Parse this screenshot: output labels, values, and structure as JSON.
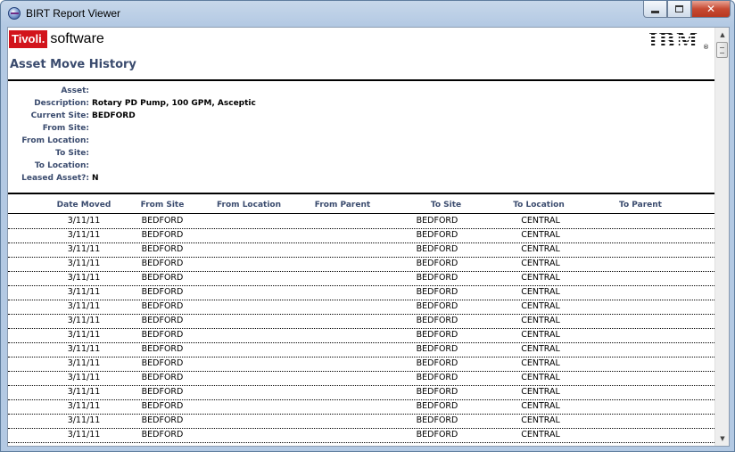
{
  "window": {
    "title": "BIRT Report Viewer",
    "minimize_label": "",
    "maximize_label": "",
    "close_label": "✕"
  },
  "header": {
    "brand_mark": "Tivoli.",
    "brand_text": "software",
    "ibm": "IBM",
    "ibm_reg": "®",
    "report_title": "Asset Move History"
  },
  "fields": [
    {
      "label": "Asset:",
      "value": ""
    },
    {
      "label": "Description:",
      "value": "Rotary PD Pump, 100 GPM, Asceptic"
    },
    {
      "label": "Current Site:",
      "value": "BEDFORD"
    },
    {
      "label": "From Site:",
      "value": ""
    },
    {
      "label": "From Location:",
      "value": ""
    },
    {
      "label": "To Site:",
      "value": ""
    },
    {
      "label": "To Location:",
      "value": ""
    },
    {
      "label": "Leased Asset?:",
      "value": "N"
    }
  ],
  "table": {
    "columns": [
      "Date Moved",
      "From Site",
      "From Location",
      "From Parent",
      "To Site",
      "To Location",
      "To Parent"
    ],
    "rows": [
      [
        "3/11/11",
        "BEDFORD",
        "",
        "",
        "BEDFORD",
        "CENTRAL",
        ""
      ],
      [
        "3/11/11",
        "BEDFORD",
        "",
        "",
        "BEDFORD",
        "CENTRAL",
        ""
      ],
      [
        "3/11/11",
        "BEDFORD",
        "",
        "",
        "BEDFORD",
        "CENTRAL",
        ""
      ],
      [
        "3/11/11",
        "BEDFORD",
        "",
        "",
        "BEDFORD",
        "CENTRAL",
        ""
      ],
      [
        "3/11/11",
        "BEDFORD",
        "",
        "",
        "BEDFORD",
        "CENTRAL",
        ""
      ],
      [
        "3/11/11",
        "BEDFORD",
        "",
        "",
        "BEDFORD",
        "CENTRAL",
        ""
      ],
      [
        "3/11/11",
        "BEDFORD",
        "",
        "",
        "BEDFORD",
        "CENTRAL",
        ""
      ],
      [
        "3/11/11",
        "BEDFORD",
        "",
        "",
        "BEDFORD",
        "CENTRAL",
        ""
      ],
      [
        "3/11/11",
        "BEDFORD",
        "",
        "",
        "BEDFORD",
        "CENTRAL",
        ""
      ],
      [
        "3/11/11",
        "BEDFORD",
        "",
        "",
        "BEDFORD",
        "CENTRAL",
        ""
      ],
      [
        "3/11/11",
        "BEDFORD",
        "",
        "",
        "BEDFORD",
        "CENTRAL",
        ""
      ],
      [
        "3/11/11",
        "BEDFORD",
        "",
        "",
        "BEDFORD",
        "CENTRAL",
        ""
      ],
      [
        "3/11/11",
        "BEDFORD",
        "",
        "",
        "BEDFORD",
        "CENTRAL",
        ""
      ],
      [
        "3/11/11",
        "BEDFORD",
        "",
        "",
        "BEDFORD",
        "CENTRAL",
        ""
      ],
      [
        "3/11/11",
        "BEDFORD",
        "",
        "",
        "BEDFORD",
        "CENTRAL",
        ""
      ],
      [
        "3/11/11",
        "BEDFORD",
        "",
        "",
        "BEDFORD",
        "CENTRAL",
        ""
      ]
    ]
  },
  "colors": {
    "label_blue": "#3a4b6e",
    "tivoli_red": "#d2141c"
  },
  "icons": {
    "app": "birt-app-icon",
    "scroll_up": "scroll-up-arrow-icon",
    "scroll_down": "scroll-down-arrow-icon"
  }
}
